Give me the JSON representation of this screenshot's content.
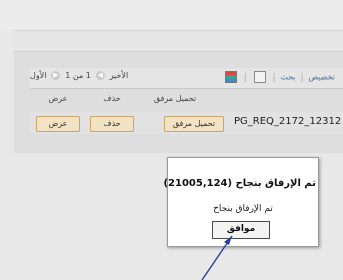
{
  "toolbar": {
    "customize": "تخصيص",
    "find": "بحث",
    "separator": "|",
    "first": "الأول",
    "page_range": "1 من 1",
    "last": "الأخير"
  },
  "columns": {
    "view": "عرض",
    "delete": "حذف",
    "upload": "تحميل مرفق"
  },
  "row": {
    "view_button": "عرض",
    "delete_button": "حذف",
    "upload_button": "تحميل مرفق",
    "request_id": "PG_REQ_2172_12312"
  },
  "dialog": {
    "title": "تم الإرفاق بنجاح (21005,124)",
    "message": "تم الإرفاق بنجاح",
    "ok_label": "موافق"
  },
  "colors": {
    "button_fill": "#f3e3c4",
    "button_border": "#c9a66a",
    "link": "#4a6a9a",
    "arrow": "#2a3f9a"
  },
  "icons": [
    "zoom-icon",
    "excel-icon",
    "first-page-icon",
    "last-page-icon"
  ]
}
